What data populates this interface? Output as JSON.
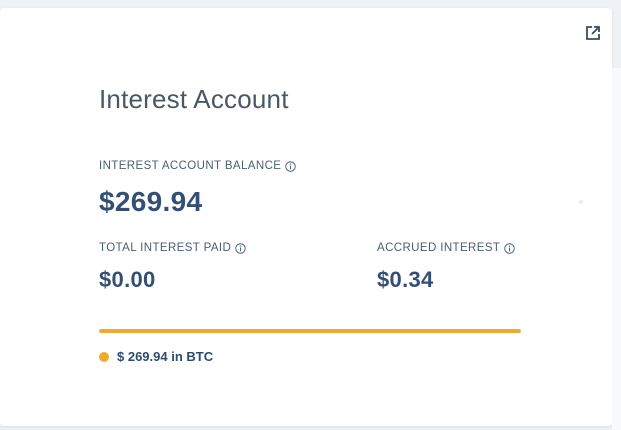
{
  "card": {
    "title": "Interest Account",
    "external_link_icon": "external-link-icon"
  },
  "balance": {
    "label": "INTEREST ACCOUNT BALANCE",
    "value": "$269.94"
  },
  "total_paid": {
    "label": "TOTAL INTEREST PAID",
    "value": "$0.00"
  },
  "accrued": {
    "label": "ACCRUED INTEREST",
    "value": "$0.34"
  },
  "allocation": {
    "fill_percent": 100,
    "legend_text": "$ 269.94 in BTC",
    "color": "#f0ab2d"
  },
  "colors": {
    "accent": "#f0ab2d",
    "value_text": "#334f76",
    "label_text": "#4c5e75",
    "title_text": "#4a5766"
  }
}
